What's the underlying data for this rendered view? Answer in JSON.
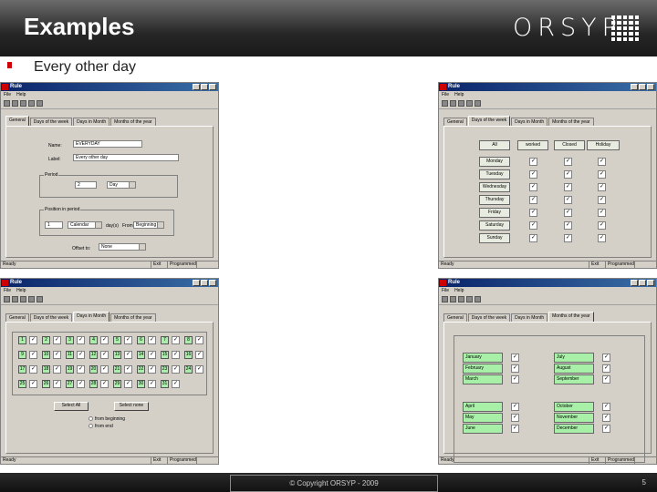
{
  "header": {
    "title": "Examples",
    "logo": "ORSYP"
  },
  "slide": {
    "bullet": "Every other day"
  },
  "footer": {
    "copyright": "© Copyright ORSYP - 2009",
    "page": "5"
  },
  "window": {
    "title": "Rule",
    "menu": [
      "File",
      "Help"
    ],
    "status_left": "Ready",
    "status_mid": "Exit",
    "status_right": "Programmed"
  },
  "tabs": [
    "General",
    "Days of the week",
    "Days in Month",
    "Months of the year"
  ],
  "general": {
    "name_label": "Name:",
    "name_value": "EVERYDAY",
    "label_label": "Label:",
    "label_value": "Every other day",
    "period_group": "Period",
    "period_value": "2",
    "period_unit": "Day",
    "position_group": "Position in period",
    "pos_value": "1",
    "pos_unit": "Calendar",
    "pos_sep": "day(s)",
    "from_label": "From",
    "from_value": "Beginning",
    "offset_label": "Offset to:",
    "offset_value": "None"
  },
  "week": {
    "headers": [
      "All",
      "worked",
      "Closed",
      "Holiday"
    ],
    "days": [
      "Monday",
      "Tuesday",
      "Wednesday",
      "Thursday",
      "Friday",
      "Saturday",
      "Sunday"
    ]
  },
  "month": {
    "numbers": [
      "1",
      "2",
      "3",
      "4",
      "5",
      "6",
      "7",
      "8",
      "9",
      "10",
      "11",
      "12",
      "13",
      "14",
      "15",
      "16",
      "17",
      "18",
      "19",
      "20",
      "21",
      "22",
      "23",
      "24",
      "25",
      "26",
      "27",
      "28",
      "29",
      "30",
      "31"
    ],
    "select_all": "Select All",
    "select_none": "Select none",
    "radio1": "from beginning",
    "radio2": "from end"
  },
  "year": {
    "months_a": [
      "January",
      "February",
      "March"
    ],
    "months_b": [
      "July",
      "August",
      "September"
    ],
    "months_c": [
      "April",
      "May",
      "June"
    ],
    "months_d": [
      "October",
      "November",
      "December"
    ]
  }
}
